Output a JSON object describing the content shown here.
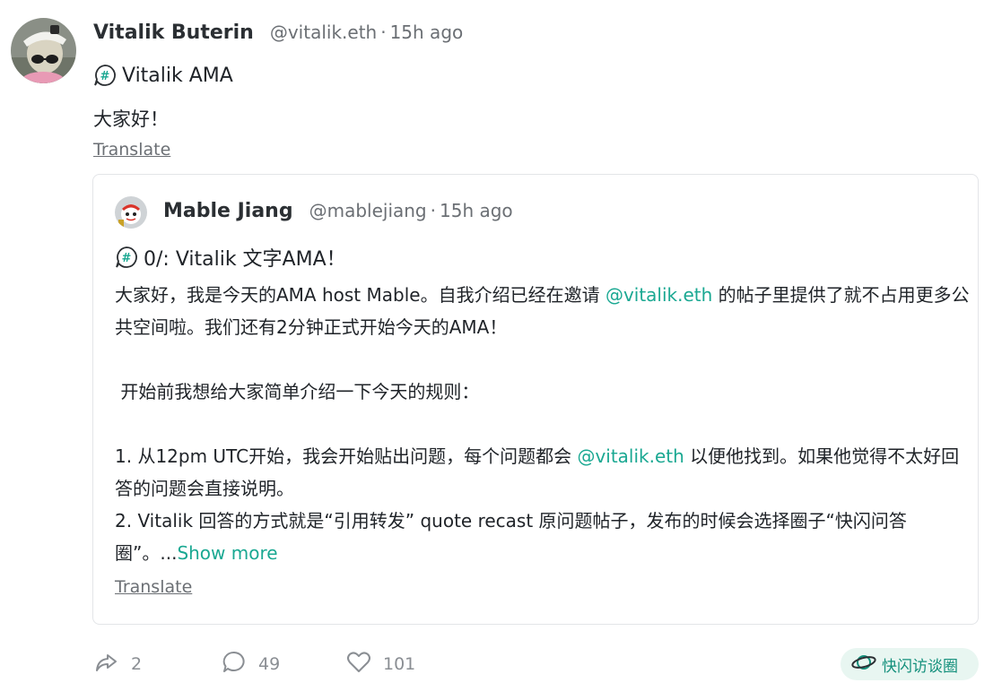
{
  "post": {
    "author_name": "Vitalik Buterin",
    "author_handle": "@vitalik.eth",
    "separator": "·",
    "time": "15h ago",
    "channel": "Vitalik AMA",
    "text": "大家好！",
    "translate_label": "Translate"
  },
  "quote": {
    "author_name": "Mable Jiang",
    "author_handle": "@mablejiang",
    "separator": "·",
    "time": "15h ago",
    "channel": "0/: Vitalik 文字AMA！",
    "paragraphs": [
      {
        "before": "大家好，我是今天的AMA host Mable。自我介绍已经在邀请 ",
        "mention": "@vitalik.eth",
        "after": " 的帖子里提供了就不占用更多公共空间啦。我们还有2分钟正式开始今天的AMA！"
      },
      {
        "text": " 开始前我想给大家简单介绍一下今天的规则："
      },
      {
        "before": "1. 从12pm UTC开始，我会开始贴出问题，每个问题都会 ",
        "mention": "@vitalik.eth",
        "after": "  以便他找到。如果他觉得不太好回答的问题会直接说明。"
      },
      {
        "before": "2. Vitalik 回答的方式就是“引用转发” quote recast 原问题帖子，发布的时候会选择圈子“快闪问答圈”。...",
        "show_more": "Show more"
      }
    ],
    "translate_label": "Translate"
  },
  "actions": {
    "recasts": "2",
    "replies": "49",
    "likes": "101",
    "channel_pill": "快闪访谈圈"
  },
  "colors": {
    "accent": "#1aa892",
    "muted": "#6b6f74",
    "pill_bg": "#e8f6f1"
  }
}
